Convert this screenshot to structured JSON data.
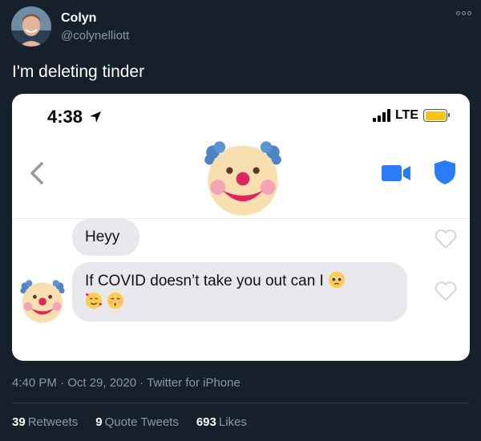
{
  "tweet": {
    "author_name": "Colyn",
    "author_handle": "@colynelliott",
    "text": "I'm deleting tinder",
    "timestamp": "4:40 PM · Oct 29, 2020",
    "source": "Twitter for iPhone",
    "more_icon": "more-options-icon"
  },
  "screenshot": {
    "status_time": "4:38",
    "network": "LTE",
    "battery_color": "#f5c518",
    "match_avatar_icon": "clown-face",
    "messages": [
      {
        "text": "Heyy"
      },
      {
        "text": "If COVID doesn’t take you out can I",
        "emojis": [
          "pleading-face",
          "smiling-face-with-hearts",
          "kissing-face-with-smiling-eyes"
        ]
      }
    ],
    "accent_color": "#2a7bf6"
  },
  "stats": {
    "retweets_count": "39",
    "retweets_label": "Retweets",
    "quote_count": "9",
    "quote_label": "Quote Tweets",
    "likes_count": "693",
    "likes_label": "Likes"
  },
  "colors": {
    "background": "#15202b",
    "secondary_text": "#8899a6"
  }
}
